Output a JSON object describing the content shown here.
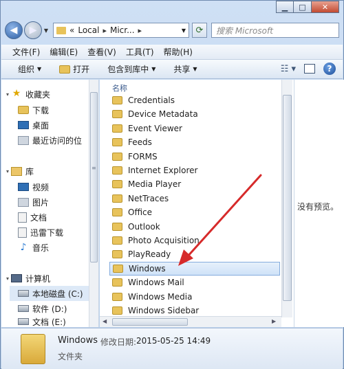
{
  "window": {
    "caption_buttons": {
      "minimize": "▁",
      "maximize": "□",
      "close": "✕"
    }
  },
  "address": {
    "overflow": "«",
    "segments": [
      "Local",
      "Micr..."
    ],
    "separator": "▸",
    "search_placeholder": "搜索 Microsoft"
  },
  "menu": [
    "文件(F)",
    "编辑(E)",
    "查看(V)",
    "工具(T)",
    "帮助(H)"
  ],
  "commands": {
    "organize": "组织",
    "open": "打开",
    "include_in_library": "包含到库中",
    "share": "共享"
  },
  "nav": {
    "favorites": {
      "label": "收藏夹",
      "items": [
        "下载",
        "桌面",
        "最近访问的位"
      ]
    },
    "libraries": {
      "label": "库",
      "items": [
        "视频",
        "图片",
        "文档",
        "迅雷下载",
        "音乐"
      ]
    },
    "computer": {
      "label": "计算机",
      "items": [
        "本地磁盘 (C:)",
        "软件 (D:)",
        "文档 (E:)"
      ]
    }
  },
  "files": {
    "column_name": "名称",
    "items": [
      "Credentials",
      "Device Metadata",
      "Event Viewer",
      "Feeds",
      "FORMS",
      "Internet Explorer",
      "Media Player",
      "NetTraces",
      "Office",
      "Outlook",
      "Photo Acquisition",
      "PlayReady",
      "Windows",
      "Windows Mail",
      "Windows Media",
      "Windows Sidebar"
    ],
    "selected_index": 12
  },
  "preview": {
    "message": "没有预览。"
  },
  "details": {
    "name": "Windows",
    "date_label": "修改日期:",
    "date_value": "2015-05-25 14:49",
    "type": "文件夹"
  },
  "colors": {
    "annotation_arrow": "#d62a2a",
    "selection": "#cfe2f8"
  }
}
